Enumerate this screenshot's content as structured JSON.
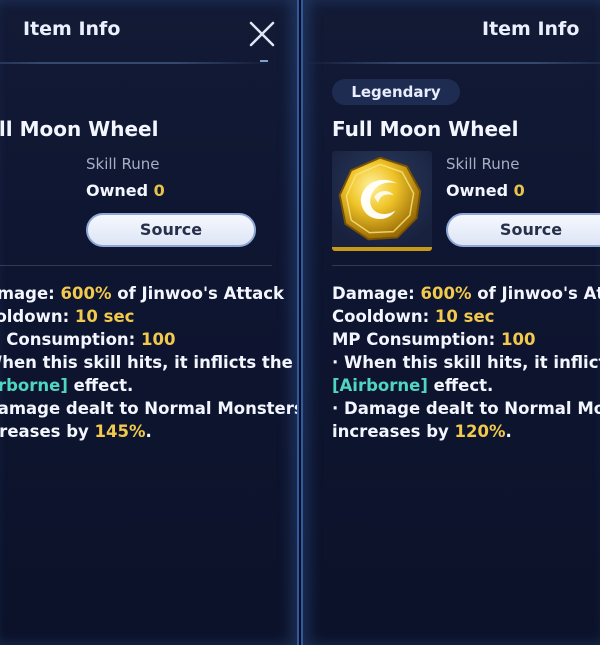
{
  "item": {
    "title": "Item Info",
    "rarity": "Legendary",
    "name": "Full Moon Wheel",
    "type": "Skill Rune",
    "owned_label": "Owned",
    "owned_count": "0",
    "source_label": "Source",
    "desc": {
      "damage_label": "Damage: ",
      "damage_value": "600%",
      "damage_suffix": " of Jinwoo's Attack",
      "cooldown_label": "Cooldown: ",
      "cooldown_value": "10 sec",
      "mp_label": "MP Consumption: ",
      "mp_value": "100",
      "hit_text_1": " · When this skill hits, it inflicts the",
      "status_effect": "[Airborne]",
      "hit_text_2": " effect.",
      "bonus_text_1": " · Damage dealt to Normal Monsters",
      "bonus_text_2": "increases by ",
      "bonus_value_left": "145%",
      "bonus_value_right": "120%",
      "period": "."
    }
  },
  "icons": {
    "close": "close-x-icon",
    "item": "golden-moon-wheel-icon"
  },
  "colors": {
    "highlight": "#f2c94c",
    "status": "#4fd6c0",
    "badge_bg": "#1f2c52",
    "border": "#2f5b9e"
  }
}
